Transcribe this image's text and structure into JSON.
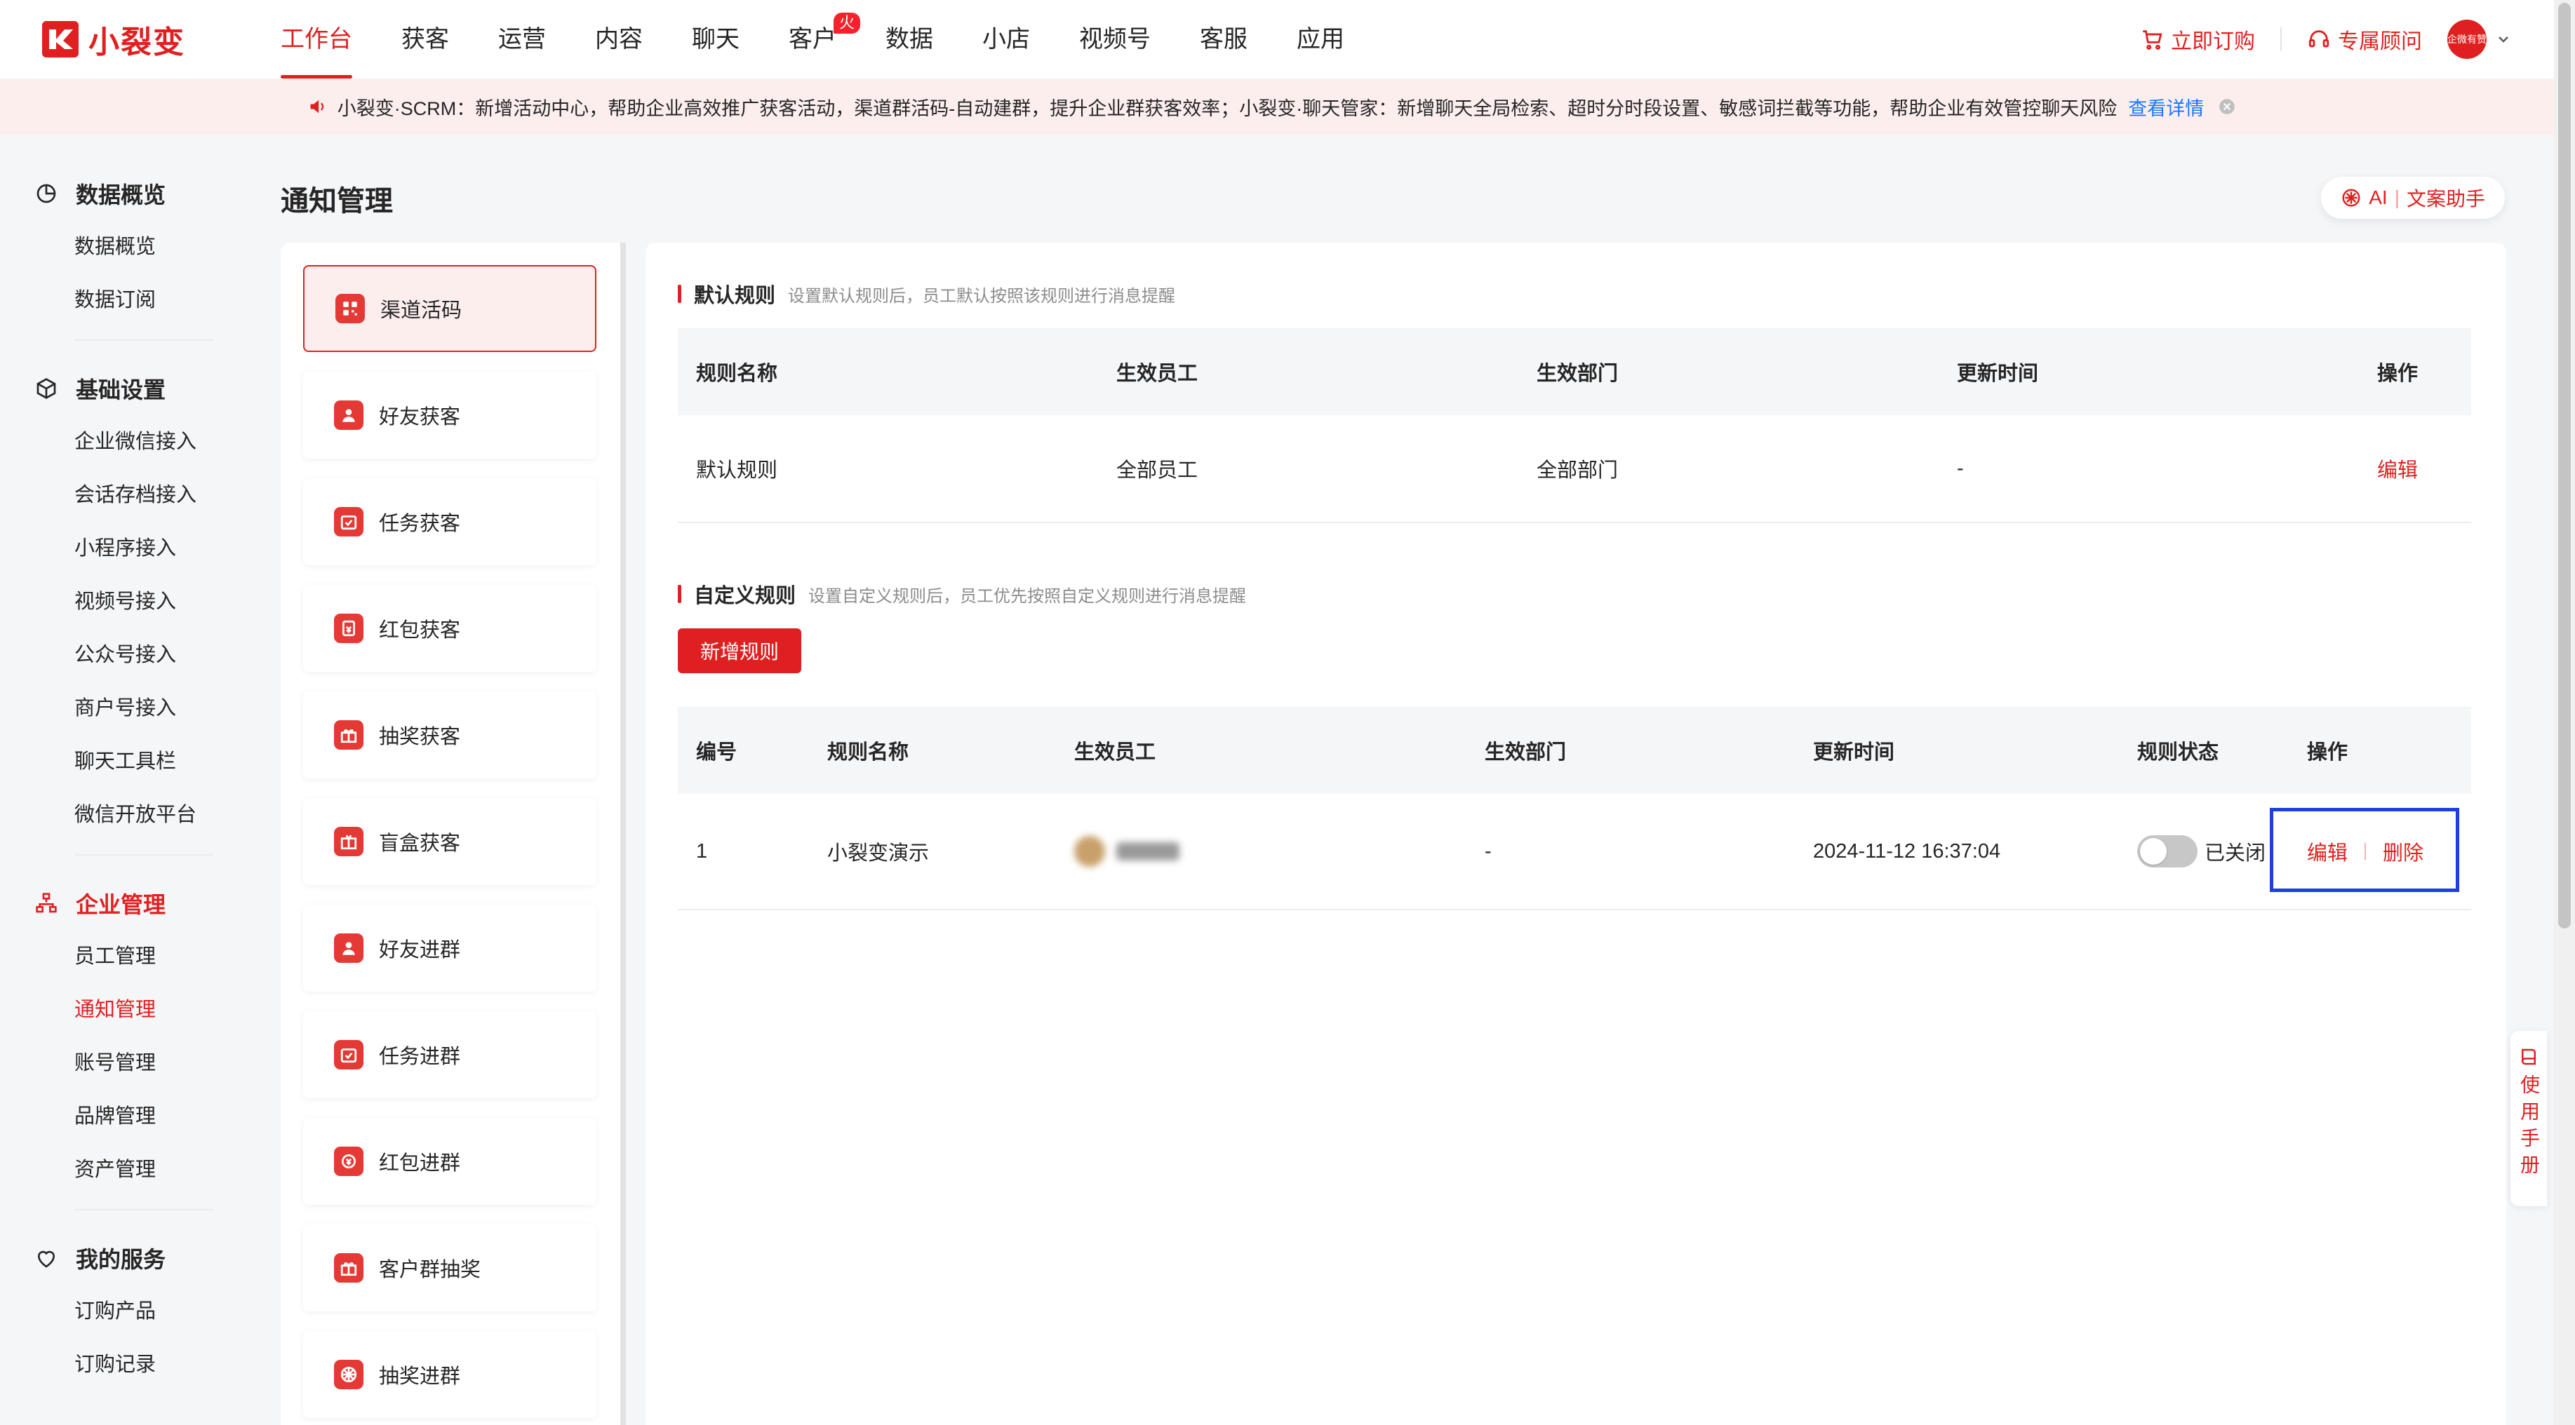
{
  "brand": {
    "name": "小裂变"
  },
  "nav": {
    "items": [
      "工作台",
      "获客",
      "运营",
      "内容",
      "聊天",
      "客户",
      "数据",
      "小店",
      "视频号",
      "客服",
      "应用"
    ],
    "hot_badge": "火爆",
    "order_label": "立即订购",
    "consultant_label": "专属顾问",
    "avatar_text": "企微有赞"
  },
  "announcement": {
    "text": "小裂变·SCRM：新增活动中心，帮助企业高效推广获客活动，渠道群活码-自动建群，提升企业群获客效率；小裂变·聊天管家：新增聊天全局检索、超时分时段设置、敏感词拦截等功能，帮助企业有效管控聊天风险",
    "link": "查看详情"
  },
  "sidebar": {
    "groups": [
      {
        "title": "数据概览",
        "items": [
          "数据概览",
          "数据订阅"
        ]
      },
      {
        "title": "基础设置",
        "items": [
          "企业微信接入",
          "会话存档接入",
          "小程序接入",
          "视频号接入",
          "公众号接入",
          "商户号接入",
          "聊天工具栏",
          "微信开放平台"
        ]
      },
      {
        "title": "企业管理",
        "items": [
          "员工管理",
          "通知管理",
          "账号管理",
          "品牌管理",
          "资产管理"
        ]
      },
      {
        "title": "我的服务",
        "items": [
          "订购产品",
          "订购记录"
        ]
      }
    ]
  },
  "page": {
    "title": "通知管理",
    "ai_label": "AI",
    "ai_assistant": "文案助手"
  },
  "categories": [
    "渠道活码",
    "好友获客",
    "任务获客",
    "红包获客",
    "抽奖获客",
    "盲盒获客",
    "好友进群",
    "任务进群",
    "红包进群",
    "客户群抽奖",
    "抽奖进群"
  ],
  "default_rules": {
    "title": "默认规则",
    "desc": "设置默认规则后，员工默认按照该规则进行消息提醒",
    "headers": [
      "规则名称",
      "生效员工",
      "生效部门",
      "更新时间",
      "操作"
    ],
    "rows": [
      {
        "name": "默认规则",
        "employees": "全部员工",
        "departments": "全部部门",
        "updated": "-",
        "action": "编辑"
      }
    ]
  },
  "custom_rules": {
    "title": "自定义规则",
    "desc": "设置自定义规则后，员工优先按照自定义规则进行消息提醒",
    "add_button": "新增规则",
    "headers": [
      "编号",
      "规则名称",
      "生效员工",
      "生效部门",
      "更新时间",
      "规则状态",
      "操作"
    ],
    "rows": [
      {
        "id": "1",
        "name": "小裂变演示",
        "departments": "-",
        "updated": "2024-11-12 16:37:04",
        "status": "已关闭",
        "edit": "编辑",
        "delete": "删除"
      }
    ]
  },
  "manual": {
    "label": "使用手册"
  },
  "colors": {
    "accent": "#e02020",
    "link": "#1677ff",
    "highlight": "#1e3fe0"
  }
}
